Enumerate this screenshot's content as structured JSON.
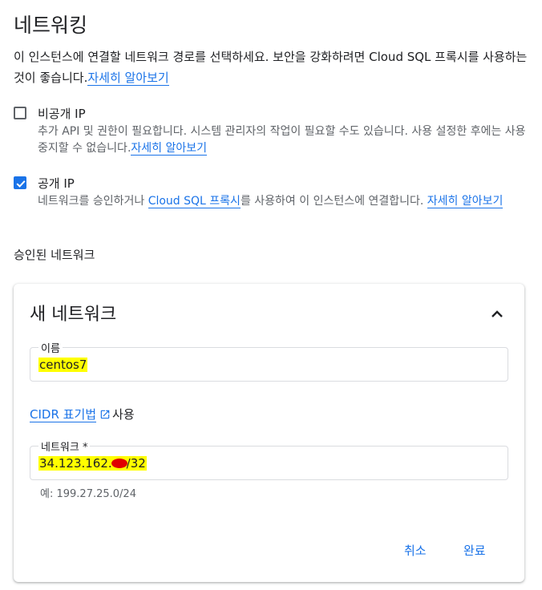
{
  "page": {
    "title": "네트워킹",
    "description": "이 인스턴스에 연결할 네트워크 경로를 선택하세요. 보안을 강화하려면 Cloud SQL 프록시를 사용하는 것이 좋습니다.",
    "description_link": "자세히 알아보기"
  },
  "private_ip": {
    "label": "비공개 IP",
    "checked": false,
    "description": "추가 API 및 권한이 필요합니다. 시스템 관리자의 작업이 필요할 수도 있습니다. 사용 설정한 후에는 사용 중지할 수 없습니다.",
    "link": "자세히 알아보기"
  },
  "public_ip": {
    "label": "공개 IP",
    "checked": true,
    "description_before": "네트워크를 승인하거나 ",
    "proxy_link": "Cloud SQL 프록시",
    "description_after": "를 사용하여 이 인스턴스에 연결합니다. ",
    "link": "자세히 알아보기"
  },
  "authorized_networks_label": "승인된 네트워크",
  "new_network": {
    "title": "새 네트워크",
    "name_field": {
      "label": "이름",
      "value": "centos7"
    },
    "cidr_link": "CIDR 표기법",
    "cidr_suffix": "사용",
    "network_field": {
      "label": "네트워크 *",
      "value_prefix": "34.123.162.",
      "value_suffix": "/32"
    },
    "hint": "예: 199.27.25.0/24",
    "cancel_label": "취소",
    "done_label": "완료"
  },
  "colors": {
    "accent": "#1a73e8",
    "highlight": "#ffff00",
    "redaction": "#e00000"
  },
  "icons": {
    "collapse": "chevron-up-icon",
    "external": "open-in-new-icon",
    "check": "check-icon"
  }
}
